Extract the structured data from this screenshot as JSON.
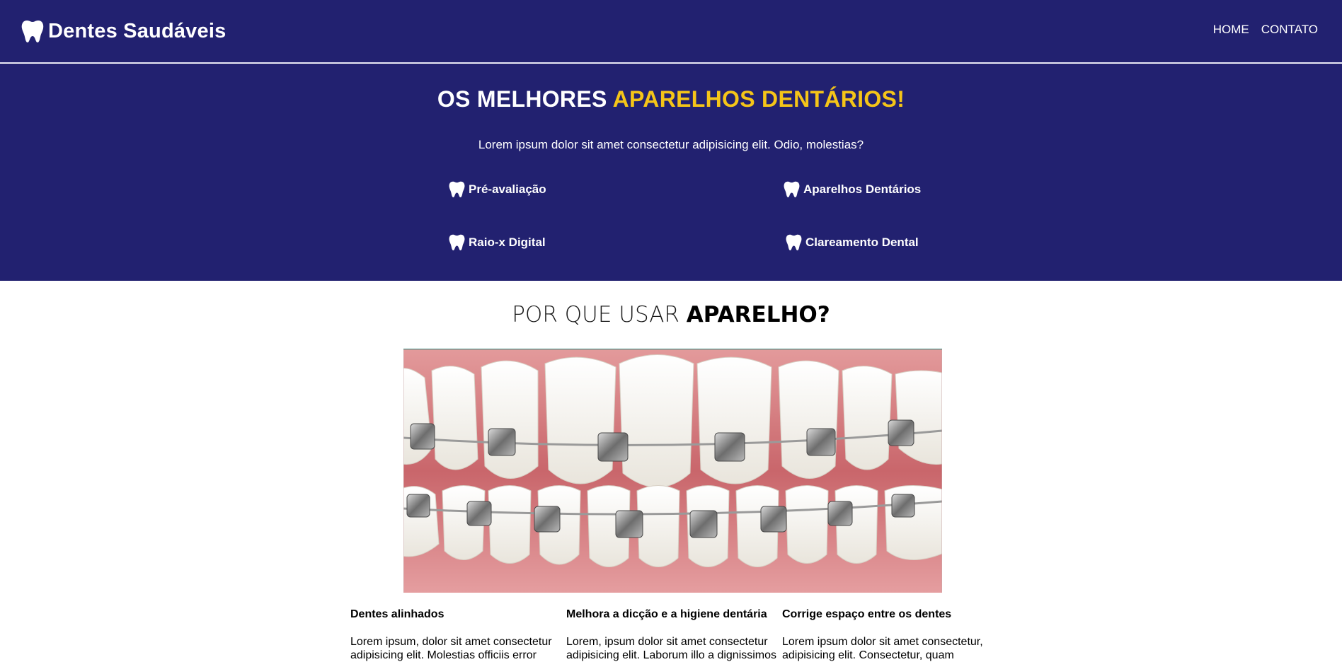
{
  "header": {
    "brand": "Dentes Saudáveis",
    "logo_icon": "tooth-icon",
    "nav": [
      {
        "label": "HOME"
      },
      {
        "label": "CONTATO"
      }
    ],
    "background": "#222170"
  },
  "hero": {
    "title_plain": "OS MELHORES ",
    "title_accent": "APARELHOS DENTÁRIOS!",
    "accent_color": "#f5c518",
    "subtitle": "Lorem ipsum dolor sit amet consectetur adipisicing elit. Odio, molestias?",
    "services": [
      {
        "label": "Pré-avaliação",
        "icon": "tooth-icon"
      },
      {
        "label": "Aparelhos Dentários",
        "icon": "tooth-icon"
      },
      {
        "label": "Raio-x Digital",
        "icon": "tooth-icon"
      },
      {
        "label": "Clareamento Dental",
        "icon": "tooth-icon"
      }
    ]
  },
  "why": {
    "title_plain": "POR QUE USAR ",
    "title_strong": "APARELHO?",
    "image_subject": "teeth with metal braces",
    "columns": [
      {
        "title": "Dentes alinhados",
        "text": "Lorem ipsum, dolor sit amet consectetur adipisicing elit. Molestias officiis error"
      },
      {
        "title": "Melhora a dicção e a higiene dentária",
        "text": "Lorem, ipsum dolor sit amet consectetur adipisicing elit. Laborum illo a dignissimos"
      },
      {
        "title": "Corrige espaço entre os dentes",
        "text": "Lorem ipsum dolor sit amet consectetur, adipisicing elit. Consectetur, quam"
      }
    ]
  }
}
